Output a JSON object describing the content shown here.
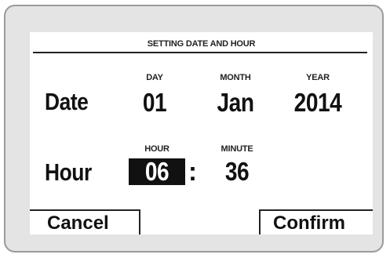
{
  "screen": {
    "title": "SETTING DATE AND HOUR"
  },
  "date_row": {
    "label": "Date",
    "day": {
      "header": "DAY",
      "value": "01"
    },
    "month": {
      "header": "MONTH",
      "value": "Jan"
    },
    "year": {
      "header": "YEAR",
      "value": "2014"
    }
  },
  "hour_row": {
    "label": "Hour",
    "hour": {
      "header": "HOUR",
      "value": "06"
    },
    "separator": ":",
    "minute": {
      "header": "MINUTE",
      "value": "36"
    }
  },
  "softkeys": {
    "cancel": "Cancel",
    "confirm": "Confirm"
  }
}
